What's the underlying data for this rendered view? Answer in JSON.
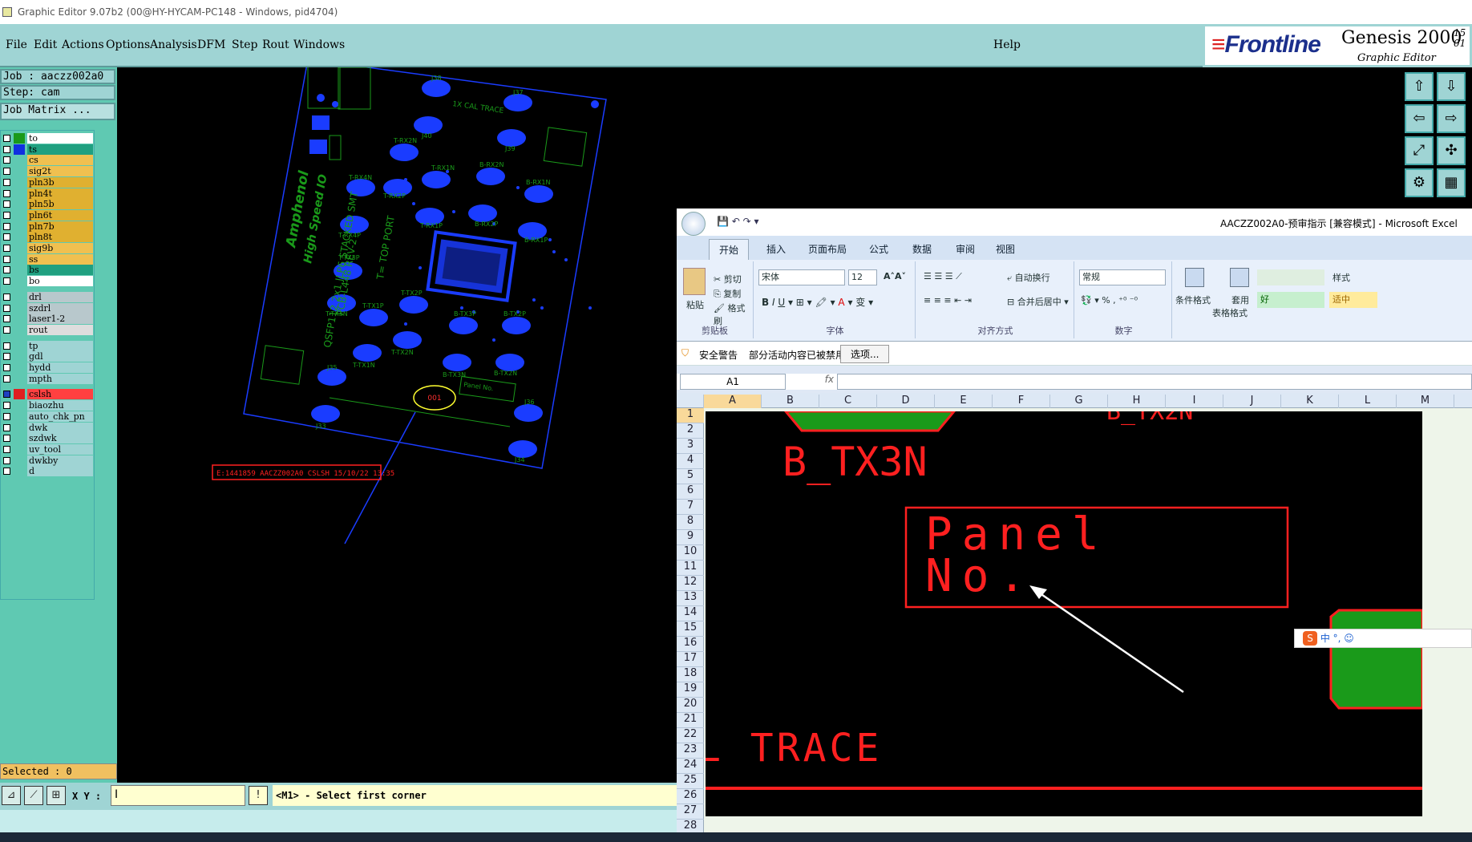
{
  "window": {
    "title": "Graphic Editor 9.07b2 (00@HY-HYCAM-PC148 - Windows, pid4704)"
  },
  "menu": {
    "items": [
      "File",
      "Edit",
      "Actions",
      "Options",
      "Analysis",
      "DFM",
      "Step",
      "Rout",
      "Windows"
    ],
    "help": "Help"
  },
  "brand": {
    "logo": "Frontline",
    "product": "Genesis 2000",
    "subtitle": "Graphic Editor",
    "version": "15",
    "version2": "01"
  },
  "job": {
    "label": "Job : aaczz002a0",
    "step": "Step: cam",
    "matrix_button": "Job Matrix ..."
  },
  "layers": [
    {
      "name": "to",
      "color": "#1a9a1a",
      "bg": "#ffffff",
      "checked": false
    },
    {
      "name": "ts",
      "color": "#1030e0",
      "bg": "#20a080",
      "checked": false
    },
    {
      "name": "cs",
      "color": "",
      "bg": "#f0c050",
      "checked": false
    },
    {
      "name": "sig2t",
      "color": "",
      "bg": "#f0c050",
      "checked": false
    },
    {
      "name": "pln3b",
      "color": "",
      "bg": "#e0b030",
      "checked": false
    },
    {
      "name": "pln4t",
      "color": "",
      "bg": "#e0b030",
      "checked": false
    },
    {
      "name": "pln5b",
      "color": "",
      "bg": "#e0b030",
      "checked": false
    },
    {
      "name": "pln6t",
      "color": "",
      "bg": "#e0b030",
      "checked": false
    },
    {
      "name": "pln7b",
      "color": "",
      "bg": "#e0b030",
      "checked": false
    },
    {
      "name": "pln8t",
      "color": "",
      "bg": "#e0b030",
      "checked": false
    },
    {
      "name": "sig9b",
      "color": "",
      "bg": "#f0c050",
      "checked": false
    },
    {
      "name": "ss",
      "color": "",
      "bg": "#f0c050",
      "checked": false
    },
    {
      "name": "bs",
      "color": "",
      "bg": "#20a080",
      "checked": false
    },
    {
      "name": "bo",
      "color": "",
      "bg": "#ffffff",
      "checked": false
    },
    {
      "name": "drl",
      "color": "",
      "bg": "#b8c8cc",
      "checked": false
    },
    {
      "name": "szdrl",
      "color": "",
      "bg": "#b8c8cc",
      "checked": false
    },
    {
      "name": "laser1-2",
      "color": "",
      "bg": "#b8c8cc",
      "checked": false
    },
    {
      "name": "rout",
      "color": "",
      "bg": "#dddddd",
      "checked": false
    },
    {
      "name": "tp",
      "color": "",
      "bg": "#9fd4d4",
      "checked": false
    },
    {
      "name": "gdl",
      "color": "",
      "bg": "#9fd4d4",
      "checked": false
    },
    {
      "name": "hydd",
      "color": "",
      "bg": "#9fd4d4",
      "checked": false
    },
    {
      "name": "mpth",
      "color": "",
      "bg": "#9fd4d4",
      "checked": false
    },
    {
      "name": "cslsh",
      "color": "#e02020",
      "bg": "#ff4040",
      "checked": true
    },
    {
      "name": "biaozhu",
      "color": "",
      "bg": "#9fd4d4",
      "checked": false
    },
    {
      "name": "auto_chk_pn",
      "color": "",
      "bg": "#9fd4d4",
      "checked": false
    },
    {
      "name": "dwk",
      "color": "",
      "bg": "#9fd4d4",
      "checked": false
    },
    {
      "name": "szdwk",
      "color": "",
      "bg": "#9fd4d4",
      "checked": false
    },
    {
      "name": "uv_tool",
      "color": "",
      "bg": "#9fd4d4",
      "checked": false
    },
    {
      "name": "dwkby",
      "color": "",
      "bg": "#9fd4d4",
      "checked": false
    },
    {
      "name": "d",
      "color": "",
      "bg": "#9fd4d4",
      "checked": false
    }
  ],
  "selected": "Selected : 0",
  "coord": {
    "label": "X Y :",
    "value": ""
  },
  "prompt": "<M1> - Select first corner",
  "board": {
    "brand": "Amphenol",
    "brand2": "High Speed IO",
    "part1": "QSFP112 2x1  JLP6 STACKED SMT",
    "part2": "PCB-L448 REV-2",
    "port": "T= TOP PORT",
    "cal": "1X CAL TRACE",
    "callout": "001",
    "panel": "Panel No.",
    "stamp": "E:1441859 AACZZ002A0 CSLSH 15/10/22 13:35",
    "pads": [
      "J38",
      "J37",
      "J40",
      "J39",
      "T-RX2N",
      "T-RX1N",
      "B-RX2N",
      "T-RX4N",
      "T-RX2P",
      "B-RX1N",
      "T-RX4P",
      "T-RX1P",
      "B-RX2P",
      "B-RX1P",
      "T-TX3P",
      "T-TX2P",
      "T-TX3N",
      "T-TX1P",
      "B-TX3P",
      "B-TX2P",
      "T-TX2N",
      "T-TX1N",
      "B-TX3N",
      "B-TX2N",
      "J35",
      "J36",
      "J33",
      "J34"
    ]
  },
  "excel": {
    "title": "AACZZ002A0-预审指示 [兼容模式] - Microsoft Excel",
    "tabs": [
      "开始",
      "插入",
      "页面布局",
      "公式",
      "数据",
      "审阅",
      "视图"
    ],
    "clipboard": {
      "paste": "粘贴",
      "cut": "剪切",
      "copy": "复制",
      "format_painter": "格式刷",
      "group": "剪贴板"
    },
    "font": {
      "name": "宋体",
      "size": "12",
      "group": "字体"
    },
    "align": {
      "wrap": "自动换行",
      "merge": "合并后居中",
      "group": "对齐方式"
    },
    "number": {
      "format": "常规",
      "group": "数字"
    },
    "styles": {
      "cond": "条件格式",
      "table1": "套用",
      "table2": "表格格式",
      "style": "样式",
      "good": "好",
      "neutral": "适中"
    },
    "security": {
      "title": "安全警告",
      "text": "部分活动内容已被禁用。",
      "button": "选项..."
    },
    "cellref": "A1",
    "fx": "fx",
    "columns": [
      "A",
      "B",
      "C",
      "D",
      "E",
      "F",
      "G",
      "H",
      "I",
      "J",
      "K",
      "L",
      "M"
    ],
    "rows": [
      "1",
      "2",
      "3",
      "4",
      "5",
      "6",
      "7",
      "8",
      "9",
      "10",
      "11",
      "12",
      "13",
      "14",
      "15",
      "16",
      "17",
      "18",
      "19",
      "20",
      "21",
      "22",
      "23",
      "24",
      "25",
      "26",
      "27",
      "28"
    ],
    "zoom_texts": {
      "b_tx3n": "B_TX3N",
      "panel": "Panel",
      "no": "No.",
      "trace": "L TRACE"
    },
    "ime": "中"
  }
}
